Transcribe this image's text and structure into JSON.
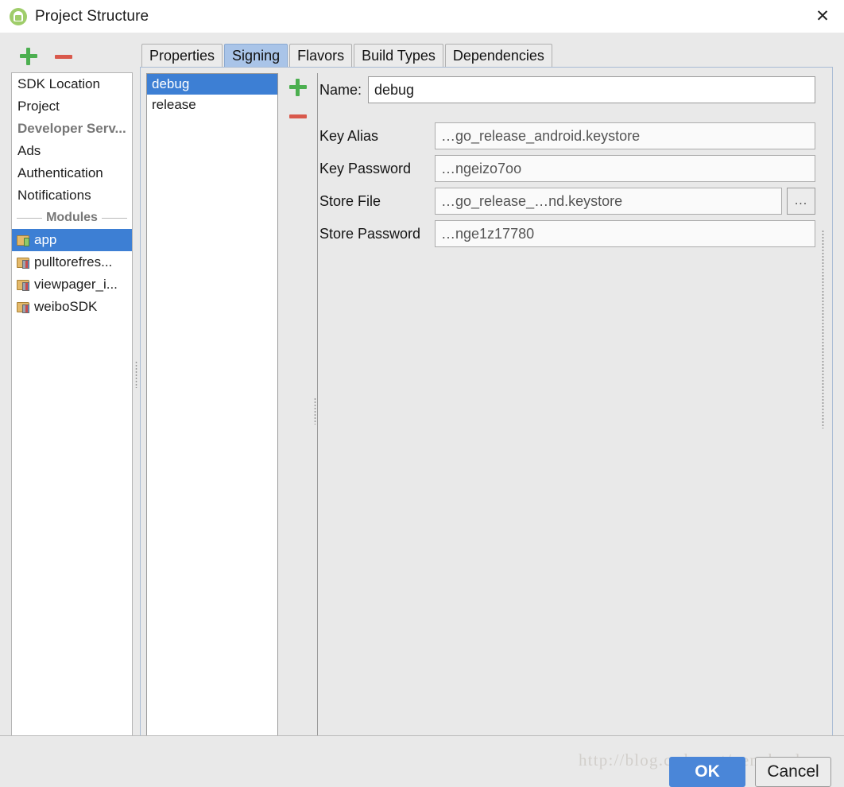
{
  "window": {
    "title": "Project Structure",
    "app_icon": "android-studio-icon",
    "close_icon": "✕"
  },
  "left_toolbar": {
    "add_label": "+",
    "remove_label": "−",
    "add_icon": "plus-icon",
    "remove_icon": "minus-icon"
  },
  "sidebar": {
    "items": [
      {
        "label": "SDK Location",
        "type": "item",
        "selected": false
      },
      {
        "label": "Project",
        "type": "item",
        "selected": false
      },
      {
        "label": "Developer Serv...",
        "type": "header",
        "selected": false
      },
      {
        "label": "Ads",
        "type": "item",
        "selected": false
      },
      {
        "label": "Authentication",
        "type": "item",
        "selected": false
      },
      {
        "label": "Notifications",
        "type": "item",
        "selected": false
      }
    ],
    "group_label": "Modules",
    "modules": [
      {
        "label": "app",
        "icon": "module-app-icon",
        "selected": true
      },
      {
        "label": "pulltorefres...",
        "icon": "module-library-icon",
        "selected": false
      },
      {
        "label": "viewpager_i...",
        "icon": "module-library-icon",
        "selected": false
      },
      {
        "label": "weiboSDK",
        "icon": "module-library-icon",
        "selected": false
      }
    ]
  },
  "tabs": [
    {
      "label": "Properties",
      "active": false
    },
    {
      "label": "Signing",
      "active": true
    },
    {
      "label": "Flavors",
      "active": false
    },
    {
      "label": "Build Types",
      "active": false
    },
    {
      "label": "Dependencies",
      "active": false
    }
  ],
  "signing": {
    "configs": [
      {
        "label": "debug",
        "selected": true
      },
      {
        "label": "release",
        "selected": false
      }
    ],
    "config_toolbar": {
      "add_label": "+",
      "remove_label": "−"
    },
    "name_label": "Name:",
    "name_value": "debug",
    "fields": [
      {
        "label": "Key Alias",
        "value": "…go_release_android.keystore",
        "obscured": true,
        "browse": false
      },
      {
        "label": "Key Password",
        "value": "…ngeizo7oo",
        "obscured": true,
        "browse": false
      },
      {
        "label": "Store File",
        "value": "…go_release_…nd.keystore",
        "obscured": true,
        "browse": true
      },
      {
        "label": "Store Password",
        "value": "…nge1z17780",
        "obscured": true,
        "browse": false
      }
    ],
    "browse_label": "..."
  },
  "footer": {
    "ok_label": "OK",
    "cancel_label": "Cancel",
    "watermark": "http://blog.csdn.net/gengbaolong"
  },
  "colors": {
    "accent": "#3d7fd4",
    "tab_active": "#a9c4e8",
    "ok_button": "#4a86d8",
    "add_green": "#4caf50",
    "remove_red": "#d9594c",
    "dialog_bg": "#e9e9e9"
  }
}
